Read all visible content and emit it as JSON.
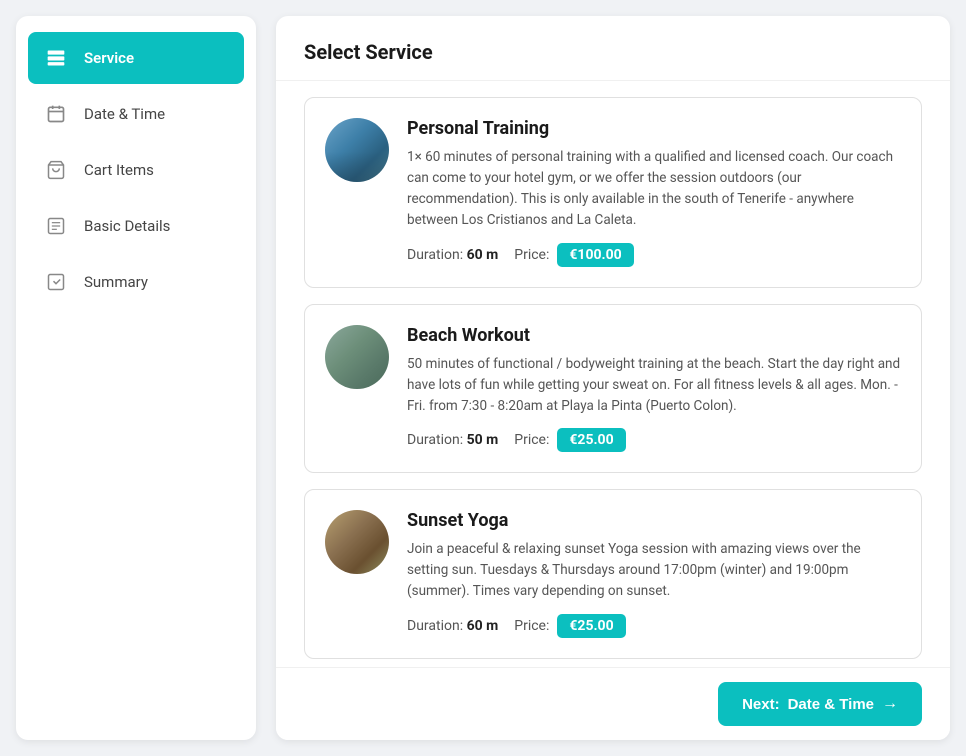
{
  "sidebar": {
    "items": [
      {
        "id": "service",
        "label": "Service",
        "active": true,
        "icon": "server-icon"
      },
      {
        "id": "date-time",
        "label": "Date & Time",
        "active": false,
        "icon": "calendar-icon"
      },
      {
        "id": "cart-items",
        "label": "Cart Items",
        "active": false,
        "icon": "cart-icon"
      },
      {
        "id": "basic-details",
        "label": "Basic Details",
        "active": false,
        "icon": "details-icon"
      },
      {
        "id": "summary",
        "label": "Summary",
        "active": false,
        "icon": "summary-icon"
      }
    ]
  },
  "main": {
    "header": "Select Service",
    "services": [
      {
        "id": "personal-training",
        "name": "Personal Training",
        "description": "1× 60 minutes of personal training with a qualified and licensed coach. Our coach can come to your hotel gym, or we offer the session outdoors (our recommendation). This is only available in the south of Tenerife - anywhere between Los Cristianos and La Caleta.",
        "duration_label": "Duration:",
        "duration_value": "60 m",
        "price_label": "Price:",
        "price": "€100.00",
        "thumb_class": "thumb-personal"
      },
      {
        "id": "beach-workout",
        "name": "Beach Workout",
        "description": "50 minutes of functional / bodyweight training at the beach. Start the day right and have lots of fun while getting your sweat on. For all fitness levels & all ages. Mon. - Fri. from 7:30 - 8:20am at Playa la Pinta (Puerto Colon).",
        "duration_label": "Duration:",
        "duration_value": "50 m",
        "price_label": "Price:",
        "price": "€25.00",
        "thumb_class": "thumb-beach"
      },
      {
        "id": "sunset-yoga",
        "name": "Sunset Yoga",
        "description": "Join a peaceful & relaxing sunset Yoga session with amazing views over the setting sun. Tuesdays & Thursdays around 17:00pm (winter) and 19:00pm (summer). Times vary depending on sunset.",
        "duration_label": "Duration:",
        "duration_value": "60 m",
        "price_label": "Price:",
        "price": "€25.00",
        "thumb_class": "thumb-yoga"
      }
    ],
    "footer": {
      "next_label": "Next:",
      "next_destination": "Date & Time",
      "next_arrow": "→"
    }
  }
}
